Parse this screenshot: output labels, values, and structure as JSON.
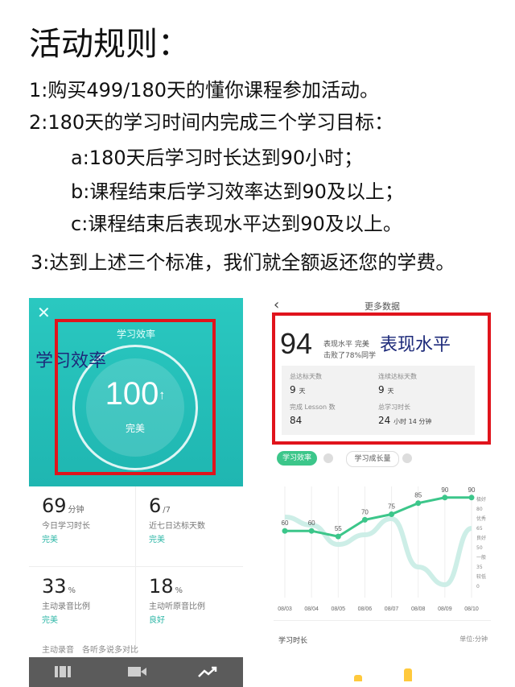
{
  "rules": {
    "title": "活动规则：",
    "line1": "1:购买499/180天的懂你课程参加活动。",
    "line2": "2:180天的学习时间内完成三个学习目标：",
    "line2a": "a:180天后学习时长达到90小时；",
    "line2b": "b:课程结束后学习效率达到90及以上；",
    "line2c": "c:课程结束后表现水平达到90及以上。",
    "line3": "3:达到上述三个标准，我们就全额返还您的学费。"
  },
  "left_screen": {
    "close_icon": "close-icon",
    "efficiency_label": "学习效率",
    "overlay_label": "学习效率",
    "score": "100",
    "score_arrow": "↑",
    "score_word": "完美",
    "stats": [
      {
        "value": "69",
        "unit": "分钟",
        "label": "今日学习时长",
        "note": "完美"
      },
      {
        "value": "6",
        "unit": "/7",
        "label": "近七日达标天数",
        "note": "完美"
      },
      {
        "value": "33",
        "unit": "%",
        "label": "主动录音比例",
        "note": "完美"
      },
      {
        "value": "18",
        "unit": "%",
        "label": "主动听原音比例",
        "note": "良好"
      }
    ],
    "bottom_text": "主动录音　各听多说多对比",
    "tabs": [
      "film-icon",
      "video-camera-icon",
      "trend-chart-icon"
    ],
    "colors": {
      "teal": "#1fb6b1",
      "highlight": "#e0141c"
    }
  },
  "right_screen": {
    "back_icon": "chevron-left-icon",
    "title": "更多数据",
    "level_score": "94",
    "level_sub1": "表现水平 完美",
    "level_sub2": "击败了78%同学",
    "overlay_label": "表现水平",
    "panel": [
      {
        "label": "总达标天数",
        "value": "9",
        "unit": "天"
      },
      {
        "label": "连续达标天数",
        "value": "9",
        "unit": "天"
      },
      {
        "label": "完成 Lesson 数",
        "value": "84",
        "unit": ""
      },
      {
        "label": "总学习时长",
        "value": "24",
        "unit": "小时 14 分钟"
      }
    ],
    "pill_active": "学习效率",
    "pill_inactive": "学习成长量",
    "section_title": "学习时长",
    "unit_label": "单位:分钟"
  },
  "chart_data": {
    "type": "line",
    "categories": [
      "08/03",
      "08/04",
      "08/05",
      "08/06",
      "08/07",
      "08/08",
      "08/09",
      "08/10"
    ],
    "series": [
      {
        "values": [
          60,
          60,
          55,
          70,
          75,
          85,
          90,
          90
        ]
      }
    ],
    "data_labels": [
      "60",
      "60",
      "55",
      "70",
      "75",
      "85",
      "90",
      "90"
    ],
    "right_axis_labels": [
      "极好",
      "80",
      "优秀",
      "65",
      "良好",
      "50",
      "一般",
      "35",
      "较低",
      "0"
    ],
    "ylim": [
      0,
      100
    ],
    "colors": {
      "line": "#3cc68a",
      "background_curve": "#cdeee7"
    }
  }
}
